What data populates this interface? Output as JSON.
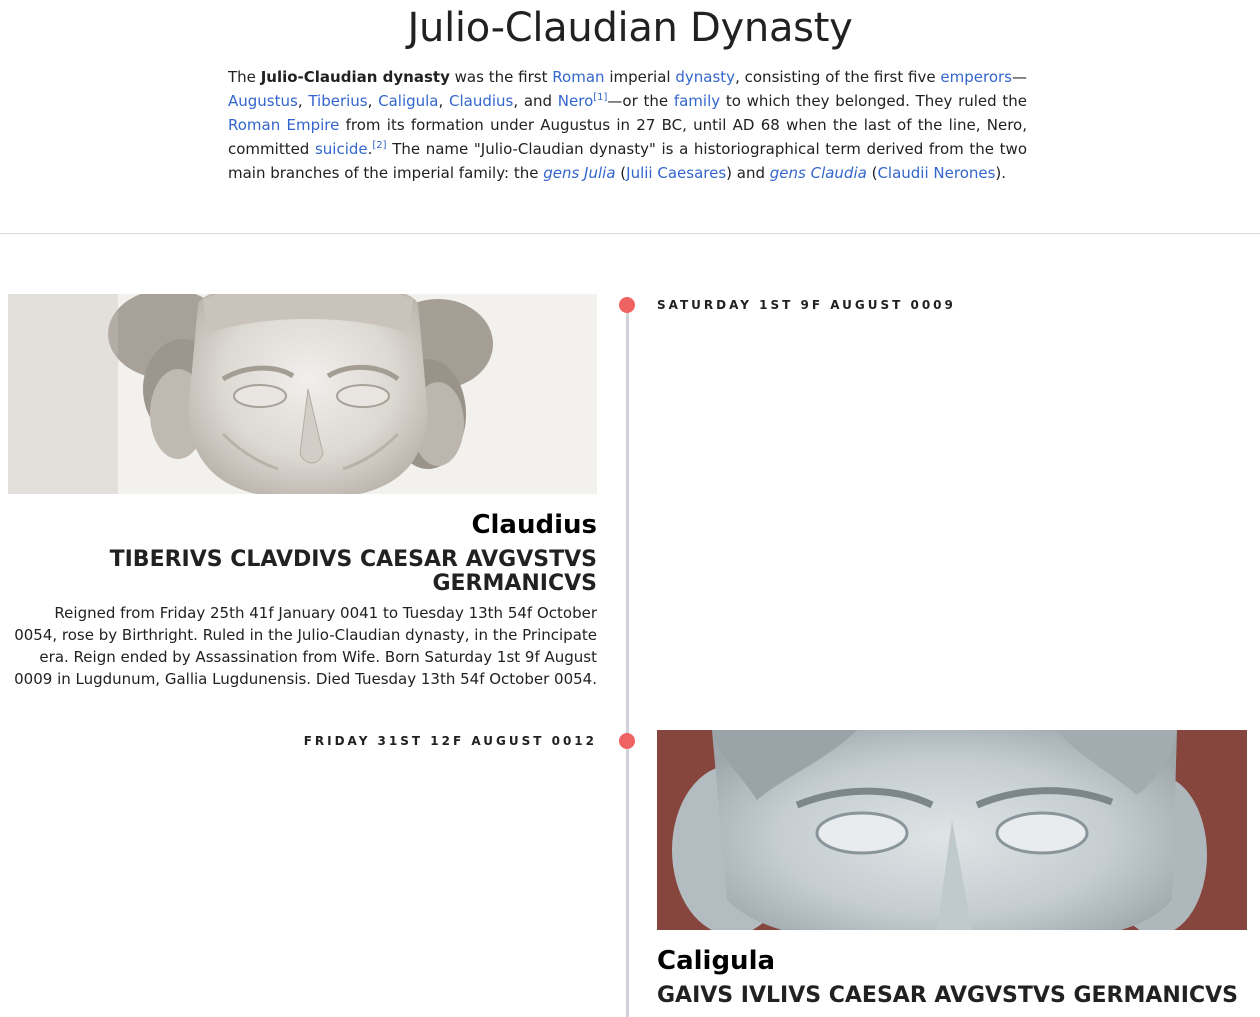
{
  "page": {
    "title": "Julio-Claudian Dynasty"
  },
  "intro": {
    "t1": "The ",
    "b1": "Julio-Claudian dynasty",
    "t2": " was the first ",
    "l_roman": "Roman",
    "t3": " imperial ",
    "l_dynasty": "dynasty",
    "t4": ", consisting of the first five ",
    "l_emperors": "emperors",
    "t5": "—",
    "l_augustus": "Augustus",
    "t6": ", ",
    "l_tiberius": "Tiberius",
    "t7": ", ",
    "l_caligula": "Caligula",
    "t8": ", ",
    "l_claudius": "Claudius",
    "t9": ", and ",
    "l_nero": "Nero",
    "ref1": "[1]",
    "t10": "—or the ",
    "l_family": "family",
    "t11": " to which they belonged. They ruled the ",
    "l_roman_empire": "Roman Empire",
    "t12": " from its formation under Augustus in 27 BC, until AD 68 when the last of the line, Nero, committed ",
    "l_suicide": "suicide",
    "t13": ".",
    "ref2": "[2]",
    "t14": " The name \"Julio-Claudian dynasty\" is a historiographical term derived from the two main branches of the imperial family: the ",
    "l_gens_julia": "gens Julia",
    "t15": " (",
    "l_julii": "Julii Caesares",
    "t16": ") and ",
    "l_gens_claudia": "gens Claudia",
    "t17": " (",
    "l_claudii": "Claudii Nerones",
    "t18": ")."
  },
  "timeline": {
    "entries": [
      {
        "date": "SATURDAY 1ST 9F AUGUST 0009",
        "name": "Claudius",
        "latin_name": "TIBERIVS CLAVDIVS CAESAR AVGVSTVS GERMANICVS",
        "description": "Reigned from Friday 25th 41f January 0041 to Tuesday 13th 54f October 0054, rose by Birthright. Ruled in the Julio-Claudian dynasty, in the Principate era. Reign ended by Assassination from Wife. Born Saturday 1st 9f August 0009 in Lugdunum, Gallia Lugdunensis. Died Tuesday 13th 54f October 0054."
      },
      {
        "date": "FRIDAY 31ST 12F AUGUST 0012",
        "name": "Caligula",
        "latin_name": "GAIVS IVLIVS CAESAR AVGVSTVS GERMANICVS"
      }
    ]
  },
  "colors": {
    "link": "#3366cc",
    "timeline_dot": "#ef6363",
    "timeline_line": "#cfd3d8",
    "caligula_backdrop": "#8c4a41"
  }
}
